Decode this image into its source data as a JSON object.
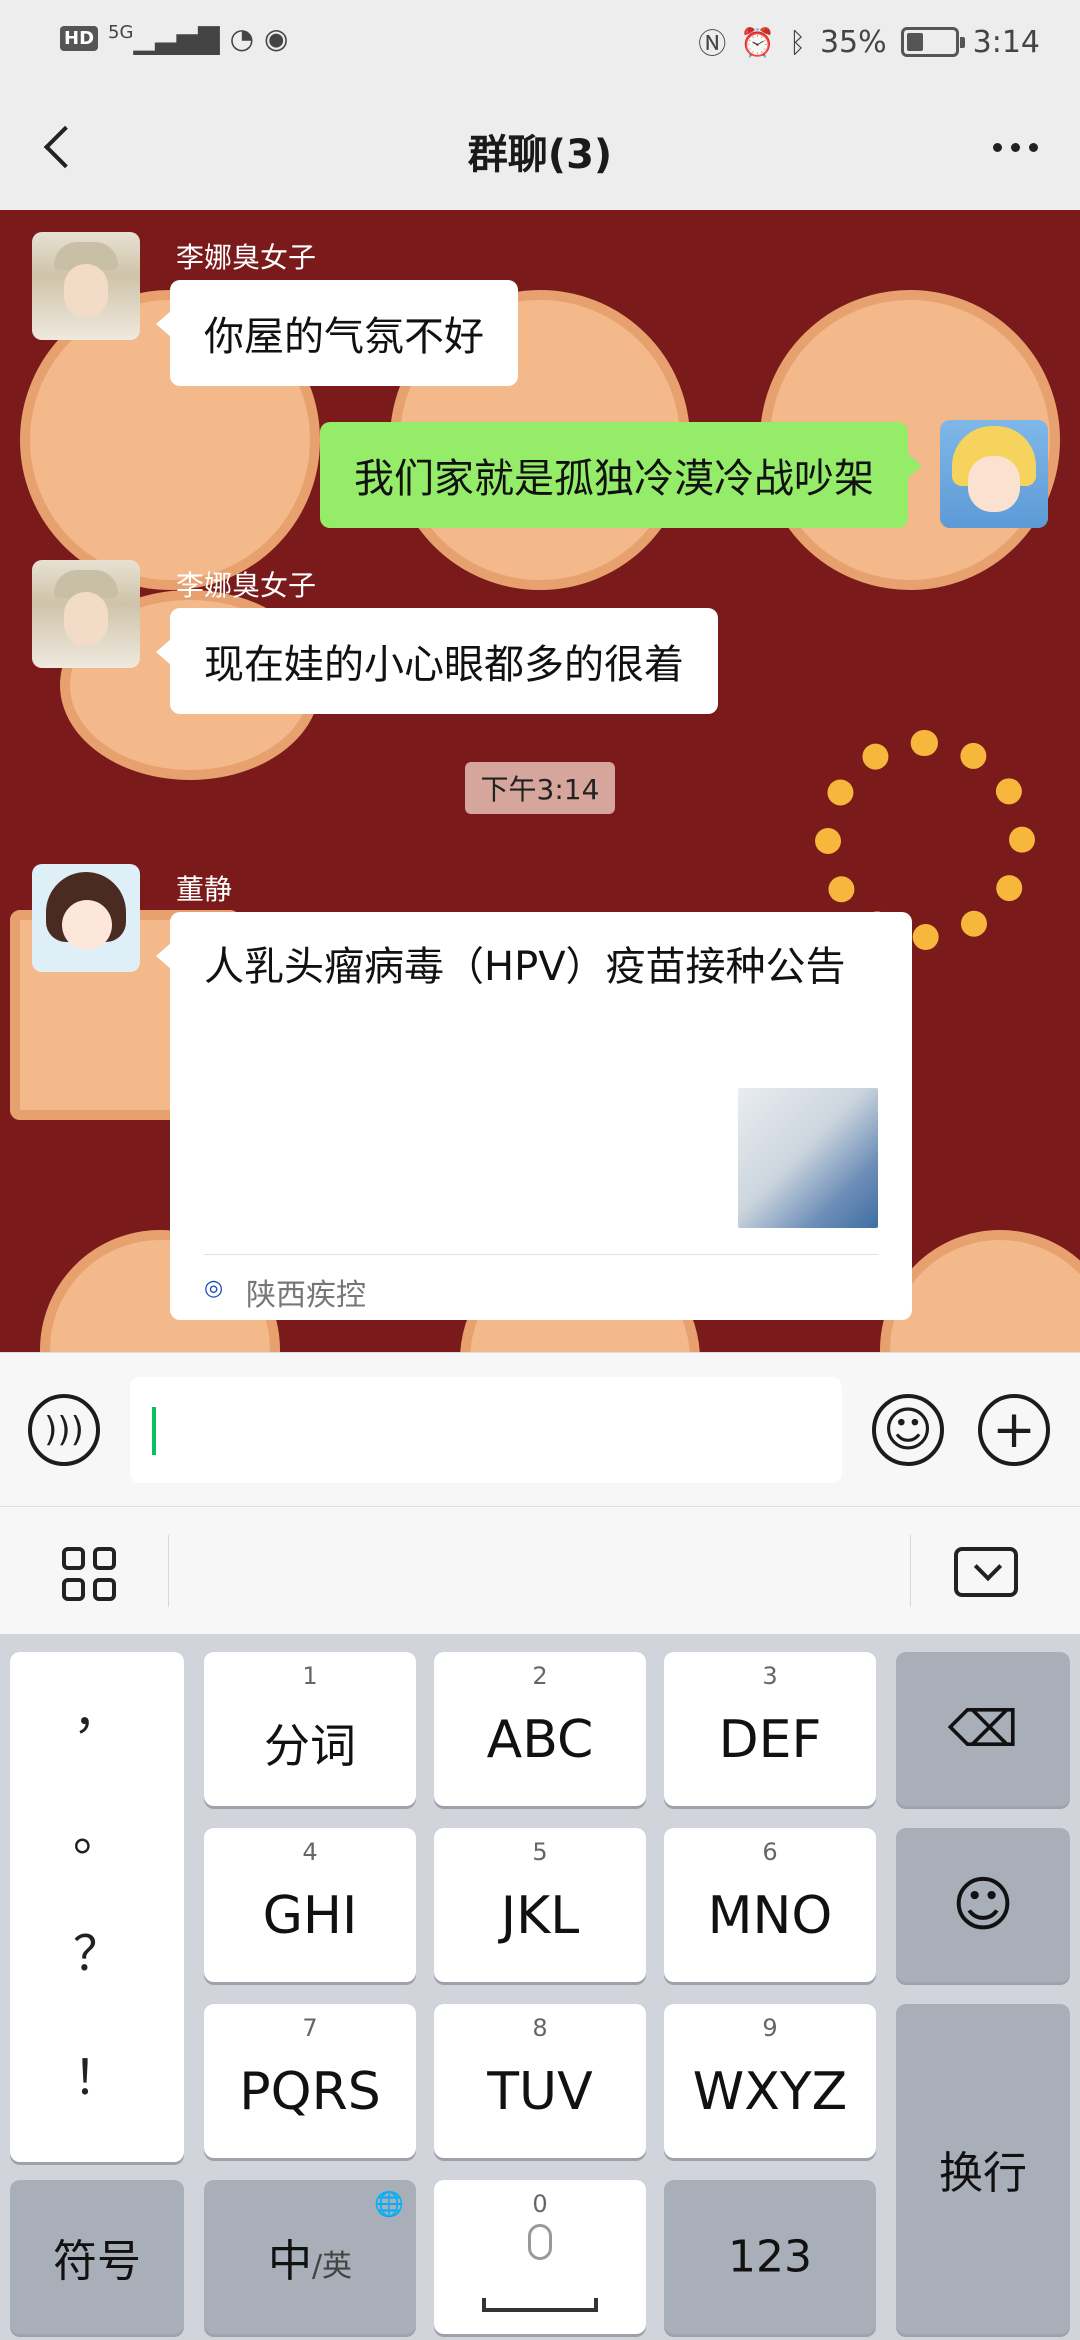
{
  "status_bar": {
    "left_icons": [
      "hd-icon",
      "5g-signal-icon",
      "wifi-icon",
      "eye-icon"
    ],
    "hd": "HD",
    "net": "5G",
    "right_icons": [
      "nfc-icon",
      "alarm-icon",
      "bluetooth-icon",
      "battery-icon"
    ],
    "battery_text": "35%",
    "battery_level": 0.35,
    "time": "3:14"
  },
  "nav": {
    "title": "群聊(3)"
  },
  "messages": [
    {
      "sender": "李娜臭女子",
      "text": "你屋的气氛不好",
      "side": "left"
    },
    {
      "sender": "",
      "text": "我们家就是孤独冷漠冷战吵架",
      "side": "right"
    },
    {
      "sender": "李娜臭女子",
      "text": "现在娃的小心眼都多的很着",
      "side": "left"
    }
  ],
  "timestamp": "下午3:14",
  "card_message": {
    "sender": "董静",
    "title": "人乳头瘤病毒（HPV）疫苗接种公告",
    "source": "陕西疾控"
  },
  "input_bar": {
    "voice_icon": "voice-icon",
    "emoji_icon": "emoji-icon",
    "plus_icon": "plus-icon",
    "value": ""
  },
  "keyboard": {
    "punctuation": [
      "，",
      "。",
      "？",
      "！"
    ],
    "keys": [
      {
        "num": "1",
        "label": "分词"
      },
      {
        "num": "2",
        "label": "ABC"
      },
      {
        "num": "3",
        "label": "DEF"
      },
      {
        "num": "4",
        "label": "GHI"
      },
      {
        "num": "5",
        "label": "JKL"
      },
      {
        "num": "6",
        "label": "MNO"
      },
      {
        "num": "7",
        "label": "PQRS"
      },
      {
        "num": "8",
        "label": "TUV"
      },
      {
        "num": "9",
        "label": "WXYZ"
      }
    ],
    "symbol_key": "符号",
    "lang_key_main": "中",
    "lang_key_sub": "/英",
    "space_num": "0",
    "num_key": "123",
    "enter_key": "换行"
  },
  "colors": {
    "chat_bg": "#7a1a1a",
    "my_bubble": "#95ec69",
    "accent": "#07c160"
  }
}
